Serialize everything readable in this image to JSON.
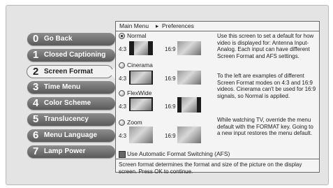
{
  "menu": {
    "items": [
      {
        "num": "0",
        "label": "Go Back"
      },
      {
        "num": "1",
        "label": "Closed Captioning"
      },
      {
        "num": "2",
        "label": "Screen Format"
      },
      {
        "num": "3",
        "label": "Time Menu"
      },
      {
        "num": "4",
        "label": "Color Scheme"
      },
      {
        "num": "5",
        "label": "Translucency"
      },
      {
        "num": "6",
        "label": "Menu Language"
      },
      {
        "num": "7",
        "label": "Lamp Power"
      }
    ],
    "selected_index": 2
  },
  "breadcrumb": {
    "root": "Main Menu",
    "sep": "▸",
    "current": "Preferences"
  },
  "formats": [
    {
      "name": "Normal",
      "selected": true,
      "ratio_a": "4:3",
      "ratio_b": "16:9"
    },
    {
      "name": "Cinerama",
      "selected": false,
      "ratio_a": "4:3",
      "ratio_b": "16:9"
    },
    {
      "name": "FlexWide",
      "selected": false,
      "ratio_a": "4:3",
      "ratio_b": "16:9"
    },
    {
      "name": "Zoom",
      "selected": false,
      "ratio_a": "4:3",
      "ratio_b": "16:9"
    }
  ],
  "description": {
    "p1": "Use this screen to set a default for how video is displayed for: Antenna Input- Analog. Each input can have different Screen Format and AFS settings.",
    "p2": "To the left are examples of different Screen Format modes on 4:3 and 16:9 videos. Cinerama can't be used for 16:9 signals, so Normal is applied.",
    "p3": "While watching TV, override the menu default with the FORMAT key. Going to a new input restores the menu default."
  },
  "afs": {
    "label": "Use Automatic Format Switching (AFS)",
    "checked": true
  },
  "footer": "Screen format determines the format and size of the picture on the display screen. Press OK to continue."
}
